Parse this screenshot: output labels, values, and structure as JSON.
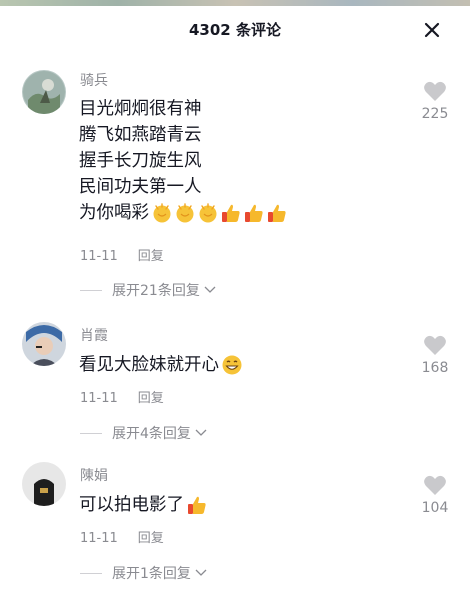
{
  "header": {
    "title": "4302 条评论"
  },
  "comments": [
    {
      "nickname": "骑兵",
      "lines": [
        "目光炯炯很有神",
        "腾飞如燕踏青云",
        "握手长刀旋生风",
        "民间功夫第一人",
        "为你喝彩"
      ],
      "date": "11-11",
      "reply_label": "回复",
      "likes": "225",
      "expand_label": "展开21条回复",
      "emojis": [
        "clap-emoji",
        "clap-emoji",
        "clap-emoji",
        "thumbs-up-emoji",
        "thumbs-up-emoji",
        "thumbs-up-emoji"
      ]
    },
    {
      "nickname": "肖霞",
      "lines": [
        "看见大脸妹就开心"
      ],
      "date": "11-11",
      "reply_label": "回复",
      "likes": "168",
      "expand_label": "展开4条回复",
      "emojis": [
        "grin-emoji"
      ]
    },
    {
      "nickname": "陳娟",
      "lines": [
        "可以拍电影了"
      ],
      "date": "11-11",
      "reply_label": "回复",
      "likes": "104",
      "expand_label": "展开1条回复",
      "emojis": [
        "thumbs-up-emoji"
      ]
    }
  ],
  "colors": {
    "text": "#161823",
    "muted": "#8a8b91",
    "like_icon": "#c9c9cc"
  }
}
